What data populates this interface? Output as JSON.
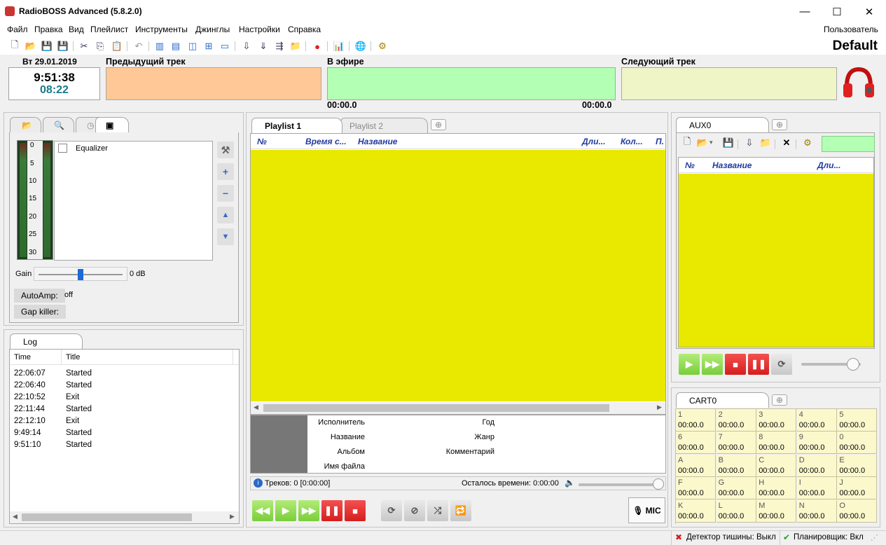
{
  "window": {
    "title": "RadioBOSS Advanced (5.8.2.0)",
    "minimize": "—",
    "maximize": "☐",
    "close": "✕"
  },
  "menu": [
    "Файл",
    "Правка",
    "Вид",
    "Плейлист",
    "Инструменты",
    "Джинглы",
    "Настройки",
    "Справка"
  ],
  "user_label": "Пользователь",
  "profile": "Default",
  "clock": {
    "date": "Вт 29.01.2019",
    "time": "9:51:38",
    "sub": "08:22"
  },
  "tracks": {
    "prev_label": "Предыдущий трек",
    "on_air_label": "В эфире",
    "next_label": "Следующий трек",
    "elapsed": "00:00.0",
    "remaining": "00:00.0"
  },
  "colors": {
    "prev": "#ffc896",
    "on_air": "#b3ffb3",
    "next": "#f0f5c8",
    "playlist_bg": "#e9e900",
    "cart_bg": "#fbf8cc"
  },
  "effects": {
    "tabs": [
      "folder-icon",
      "search-icon",
      "clock-icon",
      "effects-icon"
    ],
    "meter_scale": [
      "0",
      "5",
      "10",
      "15",
      "20",
      "25",
      "30"
    ],
    "equalizer_label": "Equalizer",
    "gain_label": "Gain",
    "gain_value": "0 dB",
    "autoamp_label": "AutoAmp:",
    "autoamp_value": "off",
    "gapkiller_label": "Gap killer:"
  },
  "log": {
    "tab": "Log",
    "columns": [
      "Time",
      "Title"
    ],
    "rows": [
      {
        "time": "22:06:07",
        "title": "Started"
      },
      {
        "time": "22:06:40",
        "title": "Started"
      },
      {
        "time": "22:10:52",
        "title": "Exit"
      },
      {
        "time": "22:11:44",
        "title": "Started"
      },
      {
        "time": "22:12:10",
        "title": "Exit"
      },
      {
        "time": "9:49:14",
        "title": "Started"
      },
      {
        "time": "9:51:10",
        "title": "Started"
      }
    ]
  },
  "playlist": {
    "tabs": [
      "Playlist 1",
      "Playlist 2"
    ],
    "columns": [
      "№",
      "Время с...",
      "Название",
      "Дли...",
      "Кол...",
      "П."
    ],
    "meta_left": [
      "Исполнитель",
      "Название",
      "Альбом",
      "Имя файла"
    ],
    "meta_right": [
      "Год",
      "Жанр",
      "Комментарий"
    ],
    "tracks_info": "Треков: 0 [0:00:00]",
    "remaining_info": "Осталось времени: 0:00:00",
    "mic_label": "MIC"
  },
  "aux": {
    "tab": "AUX0",
    "columns": [
      "№",
      "Название",
      "Дли..."
    ]
  },
  "cart": {
    "tab": "CART0",
    "keys": [
      "1",
      "2",
      "3",
      "4",
      "5",
      "6",
      "7",
      "8",
      "9",
      "0",
      "A",
      "B",
      "C",
      "D",
      "E",
      "F",
      "G",
      "H",
      "I",
      "J",
      "K",
      "L",
      "M",
      "N",
      "O"
    ],
    "time": "00:00.0"
  },
  "status": {
    "silence": "Детектор тишины: Выкл",
    "scheduler": "Планировщик: Вкл"
  }
}
